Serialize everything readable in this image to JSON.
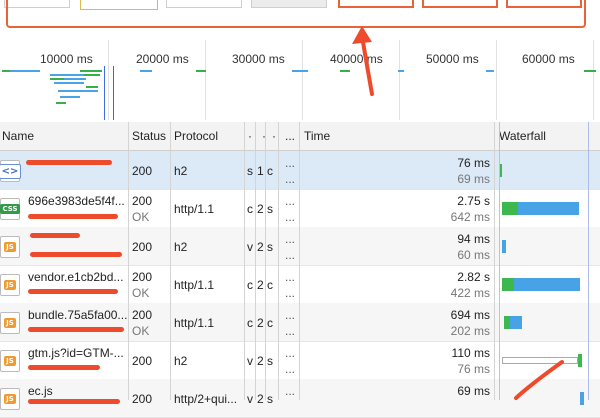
{
  "overview": {
    "ticks": [
      "10000 ms",
      "20000 ms",
      "30000 ms",
      "40000 ms",
      "50000 ms",
      "60000 ms"
    ]
  },
  "columns": {
    "name": "Name",
    "status": "Status",
    "protocol": "Protocol",
    "c1": "·",
    "c2": "·",
    "c3": "·",
    "dots": "...",
    "time": "Time",
    "waterfall": "Waterfall"
  },
  "rows": [
    {
      "icon": "html-icon",
      "badge": "<>",
      "name": "",
      "sub": "",
      "status": "200",
      "status_text": "",
      "protocol": "h2",
      "c1": "s",
      "c2": "1",
      "c3": "c",
      "time": "76 ms",
      "latency": "69 ms"
    },
    {
      "icon": "css-icon",
      "badge": "CSS",
      "name": "696e3983de5f4f...",
      "sub": "",
      "status": "200",
      "status_text": "OK",
      "protocol": "http/1.1",
      "c1": "c",
      "c2": "2",
      "c3": "s",
      "time": "2.75 s",
      "latency": "642 ms"
    },
    {
      "icon": "js-icon",
      "badge": "JS",
      "name": "",
      "sub": "",
      "status": "200",
      "status_text": "",
      "protocol": "h2",
      "c1": "v",
      "c2": "2",
      "c3": "s",
      "time": "94 ms",
      "latency": "60 ms"
    },
    {
      "icon": "js-icon",
      "badge": "JS",
      "name": "vendor.e1cb2bd...",
      "sub": "",
      "status": "200",
      "status_text": "OK",
      "protocol": "http/1.1",
      "c1": "c",
      "c2": "2",
      "c3": "c",
      "time": "2.82 s",
      "latency": "422 ms"
    },
    {
      "icon": "js-icon",
      "badge": "JS",
      "name": "bundle.75a5fa00...",
      "sub": "",
      "status": "200",
      "status_text": "OK",
      "protocol": "http/1.1",
      "c1": "c",
      "c2": "2",
      "c3": "c",
      "time": "694 ms",
      "latency": "202 ms"
    },
    {
      "icon": "js-icon",
      "badge": "JS",
      "name": "gtm.js?id=GTM-...",
      "sub": "",
      "status": "200",
      "status_text": "",
      "protocol": "h2",
      "c1": "v",
      "c2": "2",
      "c3": "s",
      "time": "110 ms",
      "latency": "76 ms"
    },
    {
      "icon": "js-icon",
      "badge": "JS",
      "name": "ec.js",
      "sub": "",
      "status": "200",
      "status_text": "",
      "protocol": "http/2+qui...",
      "c1": "v",
      "c2": "2",
      "c3": "s",
      "time": "69 ms",
      "latency": ""
    }
  ],
  "colors": {
    "annotation": "#ee4a2c",
    "selected_row": "#dce9f7",
    "waiting": "#3db84e",
    "download": "#47a2e6"
  }
}
